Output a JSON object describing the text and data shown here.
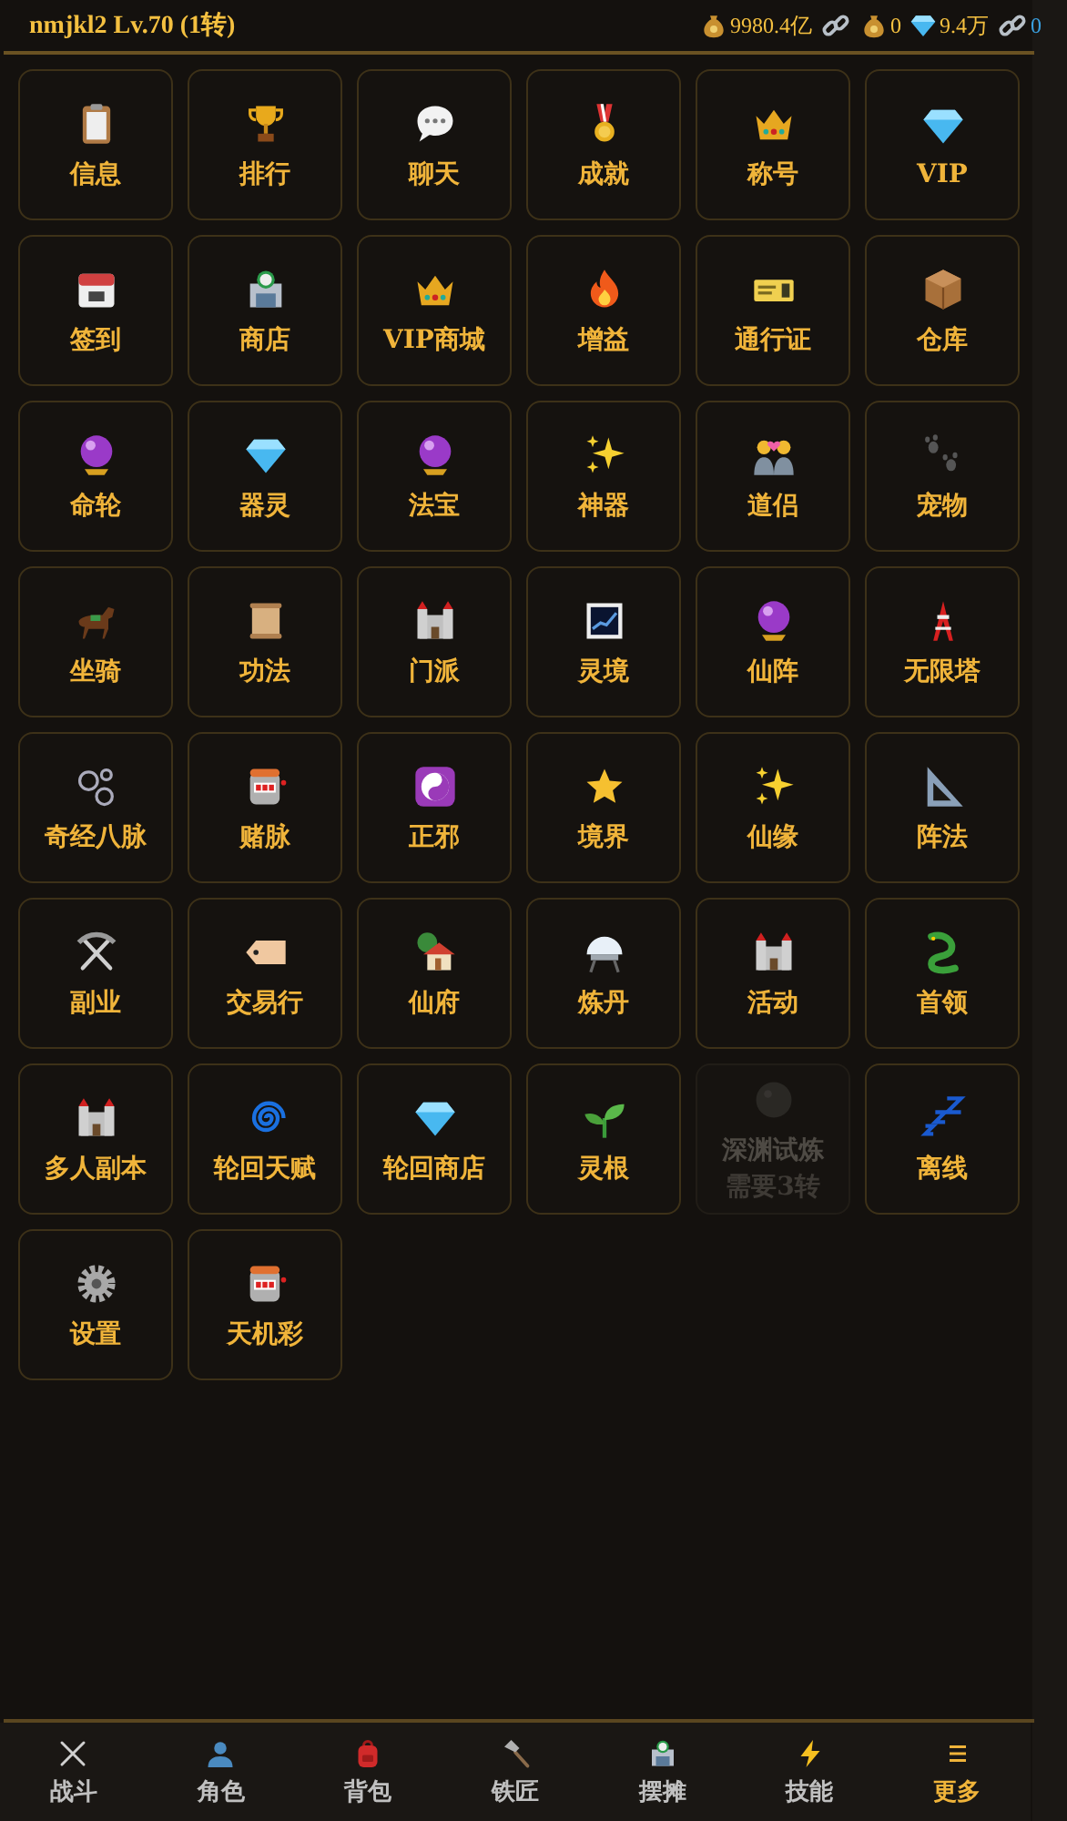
{
  "header": {
    "player": "nmjkl2 Lv.70 (1转)",
    "stats": [
      {
        "kind": "money",
        "value": "9980.4亿"
      },
      {
        "kind": "link"
      },
      {
        "kind": "money",
        "value": "0"
      },
      {
        "kind": "gem",
        "value": "9.4万"
      },
      {
        "kind": "link",
        "value": "0"
      }
    ]
  },
  "menu": [
    {
      "label": "信息",
      "disabled": false
    },
    {
      "label": "排行",
      "disabled": false
    },
    {
      "label": "聊天",
      "disabled": false
    },
    {
      "label": "成就",
      "disabled": false
    },
    {
      "label": "称号",
      "disabled": false
    },
    {
      "label": "VIP",
      "disabled": false
    },
    {
      "label": "签到",
      "disabled": false
    },
    {
      "label": "商店",
      "disabled": false
    },
    {
      "label": "VIP商城",
      "disabled": false
    },
    {
      "label": "增益",
      "disabled": false
    },
    {
      "label": "通行证",
      "disabled": false
    },
    {
      "label": "仓库",
      "disabled": false
    },
    {
      "label": "命轮",
      "disabled": false
    },
    {
      "label": "器灵",
      "disabled": false
    },
    {
      "label": "法宝",
      "disabled": false
    },
    {
      "label": "神器",
      "disabled": false
    },
    {
      "label": "道侣",
      "disabled": false
    },
    {
      "label": "宠物",
      "disabled": false
    },
    {
      "label": "坐骑",
      "disabled": false
    },
    {
      "label": "功法",
      "disabled": false
    },
    {
      "label": "门派",
      "disabled": false
    },
    {
      "label": "灵境",
      "disabled": false
    },
    {
      "label": "仙阵",
      "disabled": false
    },
    {
      "label": "无限塔",
      "disabled": false
    },
    {
      "label": "奇经八脉",
      "disabled": false
    },
    {
      "label": "赌脉",
      "disabled": false
    },
    {
      "label": "正邪",
      "disabled": false
    },
    {
      "label": "境界",
      "disabled": false
    },
    {
      "label": "仙缘",
      "disabled": false
    },
    {
      "label": "阵法",
      "disabled": false
    },
    {
      "label": "副业",
      "disabled": false
    },
    {
      "label": "交易行",
      "disabled": false
    },
    {
      "label": "仙府",
      "disabled": false
    },
    {
      "label": "炼丹",
      "disabled": false
    },
    {
      "label": "活动",
      "disabled": false
    },
    {
      "label": "首领",
      "disabled": false
    },
    {
      "label": "多人副本",
      "disabled": false
    },
    {
      "label": "轮回天赋",
      "disabled": false
    },
    {
      "label": "轮回商店",
      "disabled": false
    },
    {
      "label": "灵根",
      "disabled": false
    },
    {
      "label": "深渊试炼",
      "disabled": true,
      "requirement": "需要3转"
    },
    {
      "label": "离线",
      "disabled": false
    },
    {
      "label": "设置",
      "disabled": false
    },
    {
      "label": "天机彩",
      "disabled": false
    }
  ],
  "bottom_nav": [
    {
      "label": "战斗",
      "selected": false
    },
    {
      "label": "角色",
      "selected": false
    },
    {
      "label": "背包",
      "selected": false
    },
    {
      "label": "铁匠",
      "selected": false
    },
    {
      "label": "摆摊",
      "selected": false
    },
    {
      "label": "技能",
      "selected": false
    },
    {
      "label": "更多",
      "selected": true
    }
  ]
}
